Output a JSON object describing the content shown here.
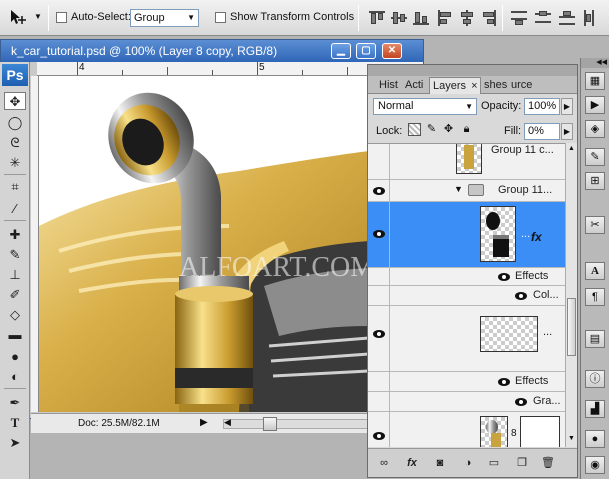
{
  "options_bar": {
    "auto_select_label": "Auto-Select:",
    "auto_select_value": "Group",
    "show_transform_label": "Show Transform Controls",
    "tool_icon": "move-tool-icon"
  },
  "document": {
    "title": "k_car_tutorial.psd @ 100% (Layer 8 copy, RGB/8)",
    "ruler_numbers": [
      "4",
      "5"
    ],
    "status_text": "Doc: 25.5M/82.1M",
    "watermark": "ALFOART.COM",
    "window_buttons": [
      "minimize",
      "restore",
      "close"
    ]
  },
  "layers_panel": {
    "tabs": [
      "Hist",
      "Acti",
      "Layers",
      "shes",
      "urce"
    ],
    "active_tab": "Layers",
    "tab_close": "×",
    "blend_mode": "Normal",
    "opacity_label": "Opacity:",
    "opacity_value": "100%",
    "lock_label": "Lock:",
    "fill_label": "Fill:",
    "fill_value": "0%",
    "layers": [
      {
        "name": "Group 11 c...",
        "type": "layer",
        "visible": false
      },
      {
        "name": "Group 11...",
        "type": "group",
        "visible": true
      },
      {
        "name": "...",
        "type": "layer",
        "visible": true,
        "selected": true,
        "fx": "fx"
      },
      {
        "name": "Effects",
        "type": "effects",
        "visible": true
      },
      {
        "name": "Col...",
        "type": "effect",
        "visible": true
      },
      {
        "name": "...",
        "type": "layer",
        "visible": true
      },
      {
        "name": "Effects",
        "type": "effects",
        "visible": true
      },
      {
        "name": "Gra...",
        "type": "effect",
        "visible": true
      },
      {
        "name": "",
        "type": "layer",
        "visible": true
      }
    ]
  },
  "colors": {
    "selected_row": "#3a8ef5",
    "titlebar": "#2f66b7",
    "gold": "#d8b24a"
  }
}
